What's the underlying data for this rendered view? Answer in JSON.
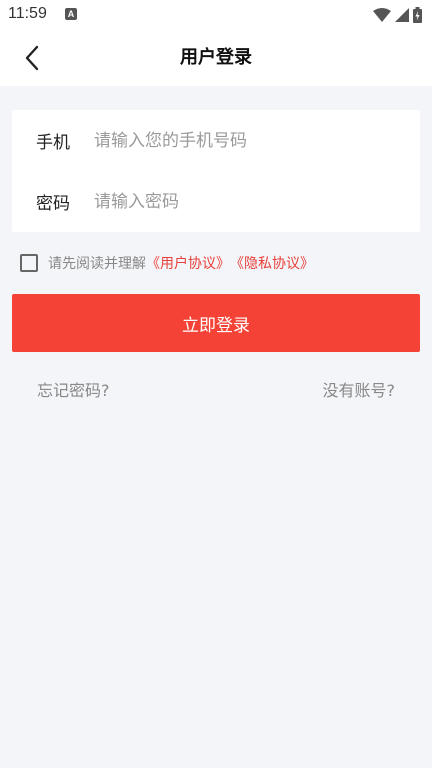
{
  "status_bar": {
    "time": "11:59",
    "notification_icon": "A"
  },
  "header": {
    "title": "用户登录",
    "back_icon": "chevron-left-icon"
  },
  "form": {
    "phone_label": "手机",
    "phone_placeholder": "请输入您的手机号码",
    "phone_value": "",
    "password_label": "密码",
    "password_placeholder": "请输入密码",
    "password_value": ""
  },
  "agreement": {
    "checked": false,
    "prefix": "请先阅读并理解",
    "user_agreement": "《用户协议》",
    "privacy_policy": "《隐私协议》"
  },
  "login_button": "立即登录",
  "links": {
    "forgot_password": "忘记密码?",
    "no_account": "没有账号?"
  },
  "colors": {
    "accent": "#f44336",
    "link_red": "#e8403a",
    "background": "#f4f5f9"
  }
}
